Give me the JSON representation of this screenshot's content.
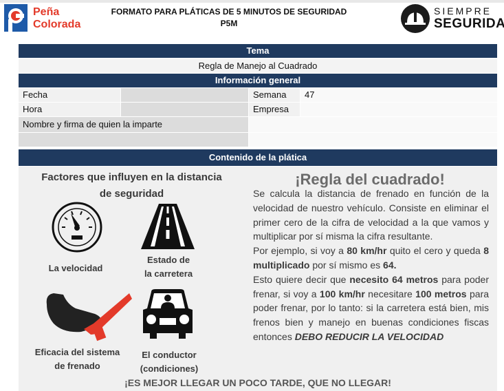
{
  "header": {
    "logo_left_line1": "Peña",
    "logo_left_line2": "Colorada",
    "title_line1": "FORMATO PARA PLÁTICAS DE 5 MINUTOS DE SEGURIDAD",
    "title_line2": "P5M",
    "logo_right_line1": "SIEMPRE",
    "logo_right_line2": "SEGURIDAD"
  },
  "form": {
    "tema_header": "Tema",
    "tema_value": "Regla de Manejo al Cuadrado",
    "info_header": "Información general",
    "fecha_label": "Fecha",
    "fecha_value": "",
    "semana_label": "Semana",
    "semana_value": "47",
    "hora_label": "Hora",
    "hora_value": "",
    "empresa_label": "Empresa",
    "empresa_value": "",
    "imparte_label": "Nombre y firma de quien la imparte",
    "imparte_value": "",
    "contenido_header": "Contenido de la plática"
  },
  "content": {
    "factors_title_line1": "Factores que influyen en la distancia",
    "factors_title_line2": "de seguridad",
    "factors": [
      {
        "icon": "speedometer-icon",
        "caption": "La velocidad",
        "caption2": ""
      },
      {
        "icon": "road-icon",
        "caption": "Estado de",
        "caption2": "la carretera"
      },
      {
        "icon": "brake-pedal-icon",
        "caption": "Eficacia del sistema",
        "caption2": "de frenado"
      },
      {
        "icon": "car-driver-icon",
        "caption": "El conductor",
        "caption2": "(condiciones)"
      }
    ],
    "rule_title": "¡Regla del cuadrado!",
    "p1": "Se calcula la distancia de frenado en función de la velocidad de nuestro vehículo. Consiste en eliminar el primer cero de la cifra de velocidad a la que vamos y multiplicar por sí misma la cifra resultante.",
    "p2_a": "Por ejemplo, si voy a ",
    "p2_b": "80 km/hr",
    "p2_c": " quito el cero y queda ",
    "p2_d": "8 multiplicado",
    "p2_e": " por sí mismo es ",
    "p2_f": "64.",
    "p3_a": "Esto quiere decir que ",
    "p3_b": "necesito 64 metros",
    "p3_c": " para poder frenar, si voy a ",
    "p3_d": "100 km/hr",
    "p3_e": " necesitare ",
    "p3_f": "100 metros",
    "p3_g": " para poder frenar, por lo tanto: si la carretera está bien, mis frenos bien y manejo en buenas condiciones fiscas entonces ",
    "p3_h": "DEBO REDUCIR LA VELOCIDAD",
    "footer": "¡ES MEJOR LLEGAR UN POCO TARDE, QUE NO LLEGAR!"
  },
  "colors": {
    "band": "#1f3a5f",
    "brand_red": "#e33a2a",
    "brand_blue": "#1e5aa8",
    "cell_grey": "#dcdcdc"
  }
}
